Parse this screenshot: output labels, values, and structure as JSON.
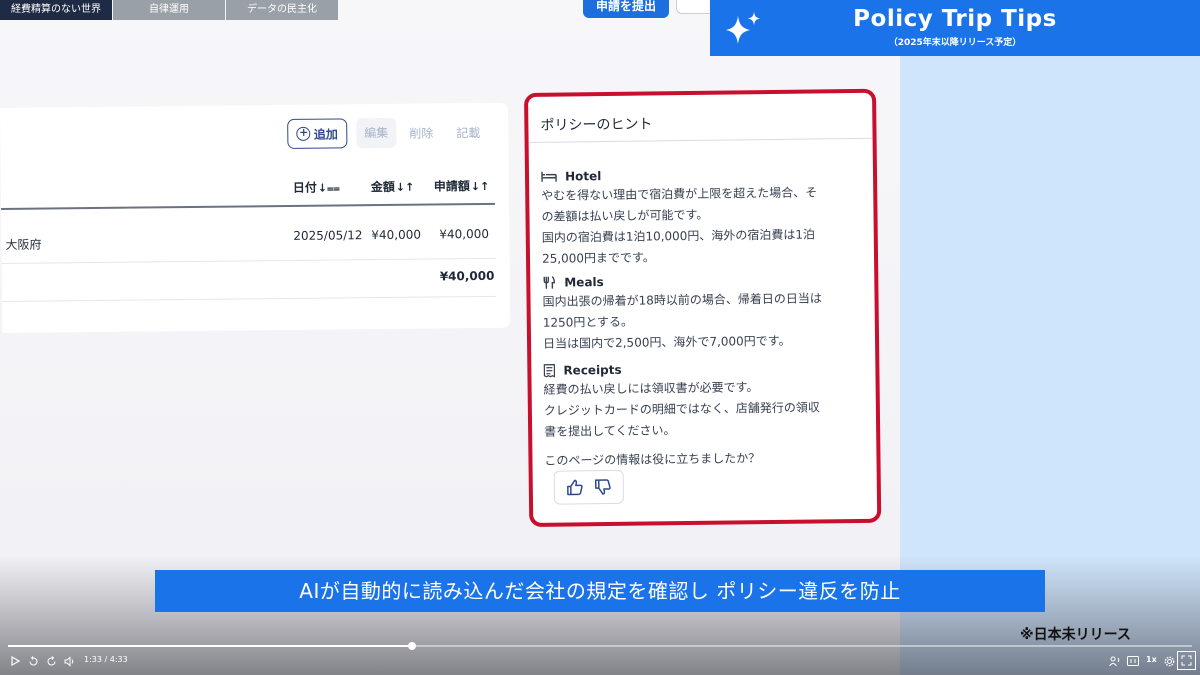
{
  "chapters": [
    {
      "label": "経費精算のない世界",
      "active": true
    },
    {
      "label": "自律運用",
      "active": false
    },
    {
      "label": "データの民主化",
      "active": false
    }
  ],
  "top_buttons": {
    "submit_label": "申請を提出"
  },
  "banner": {
    "title": "Policy Trip Tips",
    "subtitle": "（2025年末以降リリース予定）",
    "icon": "sparkle-icon",
    "color": "#1a73e8"
  },
  "toolbar": {
    "add_label": "追加",
    "edit_label": "編集",
    "delete_label": "削除",
    "note_label": "記載"
  },
  "table": {
    "columns": [
      {
        "label": "日付"
      },
      {
        "label": "金額"
      },
      {
        "label": "申請額"
      }
    ],
    "rows": [
      {
        "location": "大阪府",
        "date": "2025/05/12",
        "amount": "¥40,000",
        "claim": "¥40,000"
      }
    ],
    "total": "¥40,000"
  },
  "hint_panel": {
    "title": "ポリシーのヒント",
    "sections": [
      {
        "icon": "bed-icon",
        "heading": "Hotel",
        "lines": [
          "やむを得ない理由で宿泊費が上限を超えた場合、そ",
          "の差額は払い戻しが可能です。",
          "国内の宿泊費は1泊10,000円、海外の宿泊費は1泊",
          "25,000円までです。"
        ]
      },
      {
        "icon": "fork-knife-icon",
        "heading": "Meals",
        "lines": [
          "国内出張の帰着が18時以前の場合、帰着日の日当は",
          "1250円とする。",
          "日当は国内で2,500円、海外で7,000円です。"
        ]
      },
      {
        "icon": "receipt-icon",
        "heading": "Receipts",
        "lines": [
          "経費の払い戻しには領収書が必要です。",
          "クレジットカードの明細ではなく、店舗発行の領収",
          "書を提出してください。"
        ]
      }
    ],
    "feedback_question": "このページの情報は役に立ちましたか？",
    "border_color": "#c8102e"
  },
  "subtitle": "AIが自動的に読み込んだ会社の規定を確認し ポリシー違反を防止",
  "notice": "※日本未リリース",
  "player": {
    "time": "1:33 / 4:33",
    "progress": 0.341,
    "speed": "1x"
  }
}
